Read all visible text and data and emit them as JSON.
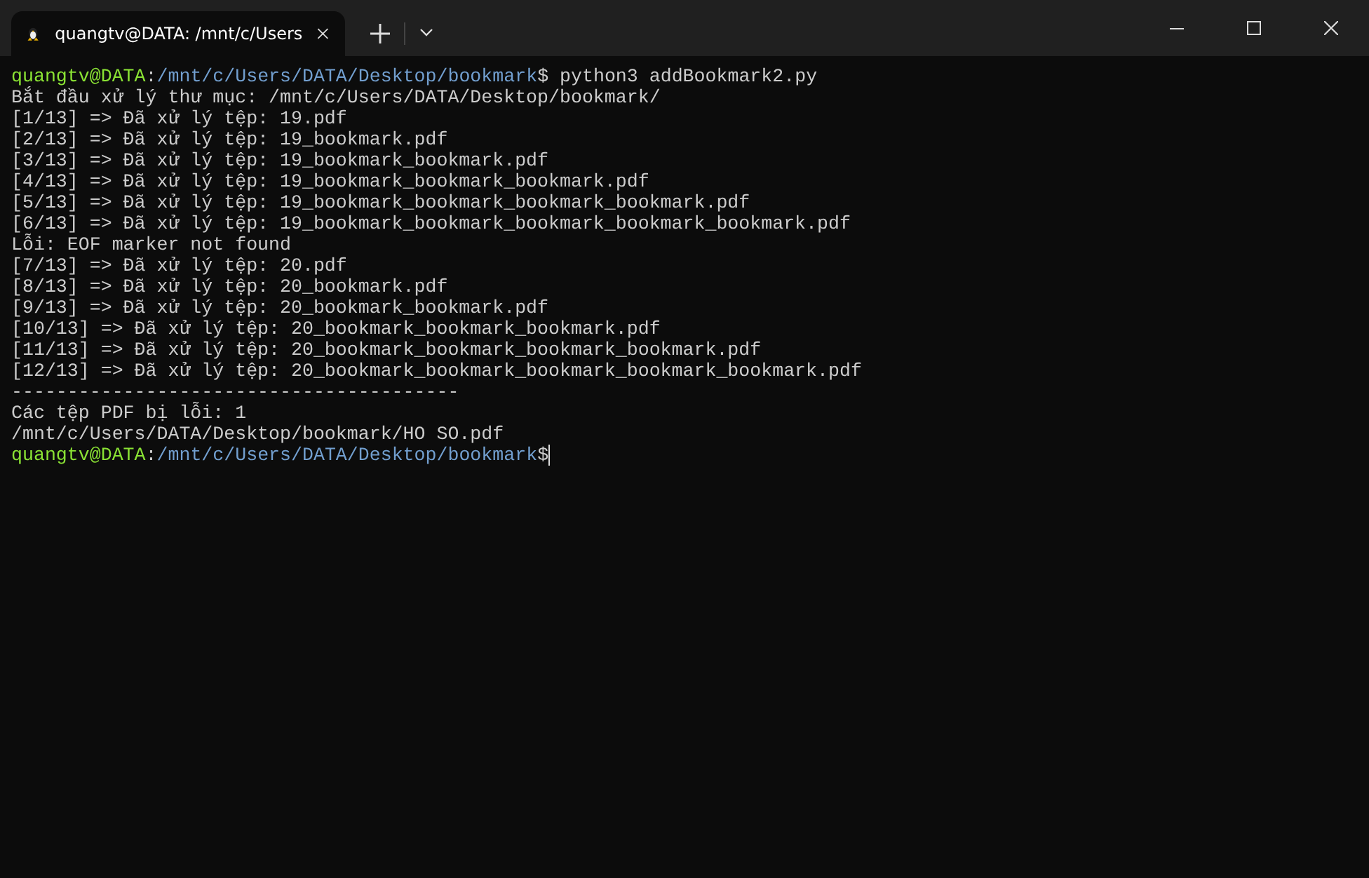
{
  "tab": {
    "title": "quangtv@DATA: /mnt/c/Users",
    "selected": true
  },
  "lines": [
    {
      "kind": "prompt",
      "user": "quangtv@DATA",
      "sep": ":",
      "path": "/mnt/c/Users/DATA/Desktop/bookmark",
      "symbol": "$",
      "command": " python3 addBookmark2.py",
      "cursor": false
    },
    {
      "kind": "output",
      "text": "Bắt đầu xử lý thư mục: /mnt/c/Users/DATA/Desktop/bookmark/"
    },
    {
      "kind": "output",
      "text": "[1/13] => Đã xử lý tệp: 19.pdf"
    },
    {
      "kind": "output",
      "text": "[2/13] => Đã xử lý tệp: 19_bookmark.pdf"
    },
    {
      "kind": "output",
      "text": "[3/13] => Đã xử lý tệp: 19_bookmark_bookmark.pdf"
    },
    {
      "kind": "output",
      "text": "[4/13] => Đã xử lý tệp: 19_bookmark_bookmark_bookmark.pdf"
    },
    {
      "kind": "output",
      "text": "[5/13] => Đã xử lý tệp: 19_bookmark_bookmark_bookmark_bookmark.pdf"
    },
    {
      "kind": "output",
      "text": "[6/13] => Đã xử lý tệp: 19_bookmark_bookmark_bookmark_bookmark_bookmark.pdf"
    },
    {
      "kind": "output",
      "text": "Lỗi: EOF marker not found"
    },
    {
      "kind": "output",
      "text": "[7/13] => Đã xử lý tệp: 20.pdf"
    },
    {
      "kind": "output",
      "text": "[8/13] => Đã xử lý tệp: 20_bookmark.pdf"
    },
    {
      "kind": "output",
      "text": "[9/13] => Đã xử lý tệp: 20_bookmark_bookmark.pdf"
    },
    {
      "kind": "output",
      "text": "[10/13] => Đã xử lý tệp: 20_bookmark_bookmark_bookmark.pdf"
    },
    {
      "kind": "output",
      "text": "[11/13] => Đã xử lý tệp: 20_bookmark_bookmark_bookmark_bookmark.pdf"
    },
    {
      "kind": "output",
      "text": "[12/13] => Đã xử lý tệp: 20_bookmark_bookmark_bookmark_bookmark_bookmark.pdf"
    },
    {
      "kind": "output",
      "text": "----------------------------------------"
    },
    {
      "kind": "output",
      "text": "Các tệp PDF bị lỗi: 1"
    },
    {
      "kind": "output",
      "text": "/mnt/c/Users/DATA/Desktop/bookmark/HO SO.pdf"
    },
    {
      "kind": "prompt",
      "user": "quangtv@DATA",
      "sep": ":",
      "path": "/mnt/c/Users/DATA/Desktop/bookmark",
      "symbol": "$",
      "cursor": true
    }
  ]
}
